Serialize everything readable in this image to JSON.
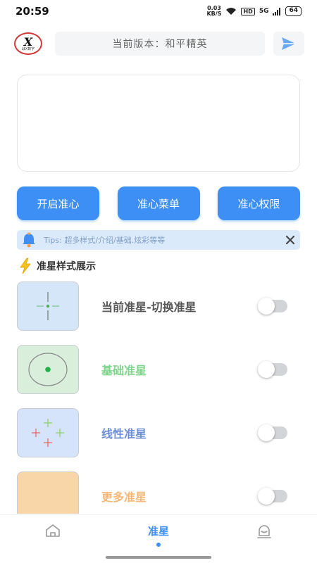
{
  "status_bar": {
    "time": "20:59",
    "speed_value": "0.03",
    "speed_unit": "KB/S",
    "hd": "HD",
    "signal": "5G",
    "battery": "64"
  },
  "header": {
    "logo_letter": "X",
    "logo_sub": "战X数字",
    "version_text": "当前版本：和平精英"
  },
  "input": {
    "placeholder": ""
  },
  "buttons": {
    "open_crosshair": "开启准心",
    "crosshair_menu": "准心菜单",
    "crosshair_permission": "准心权限"
  },
  "tips": {
    "text": "Tips: 超多样式/介绍/基础.炫彩等等"
  },
  "section": {
    "title": "准星样式展示"
  },
  "crosshair_list": [
    {
      "label": "当前准星-切换准星",
      "label_color": "#555555",
      "thumb_bg": "#d5e6f8",
      "toggle_on": false
    },
    {
      "label": "基础准星",
      "label_color": "#7fd48b",
      "thumb_bg": "#d9efdb",
      "toggle_on": false
    },
    {
      "label": "线性准星",
      "label_color": "#6e8fd8",
      "thumb_bg": "#d5e3fb",
      "toggle_on": false
    },
    {
      "label": "更多准星",
      "label_color": "#f5b878",
      "thumb_bg": "#f9d6a8",
      "toggle_on": false
    }
  ],
  "bottom_nav": {
    "home_icon": "home-icon",
    "center_label": "准星",
    "profile_icon": "profile-icon"
  },
  "colors": {
    "accent": "#3d8ff5",
    "tips_bg": "#dbeafb"
  }
}
